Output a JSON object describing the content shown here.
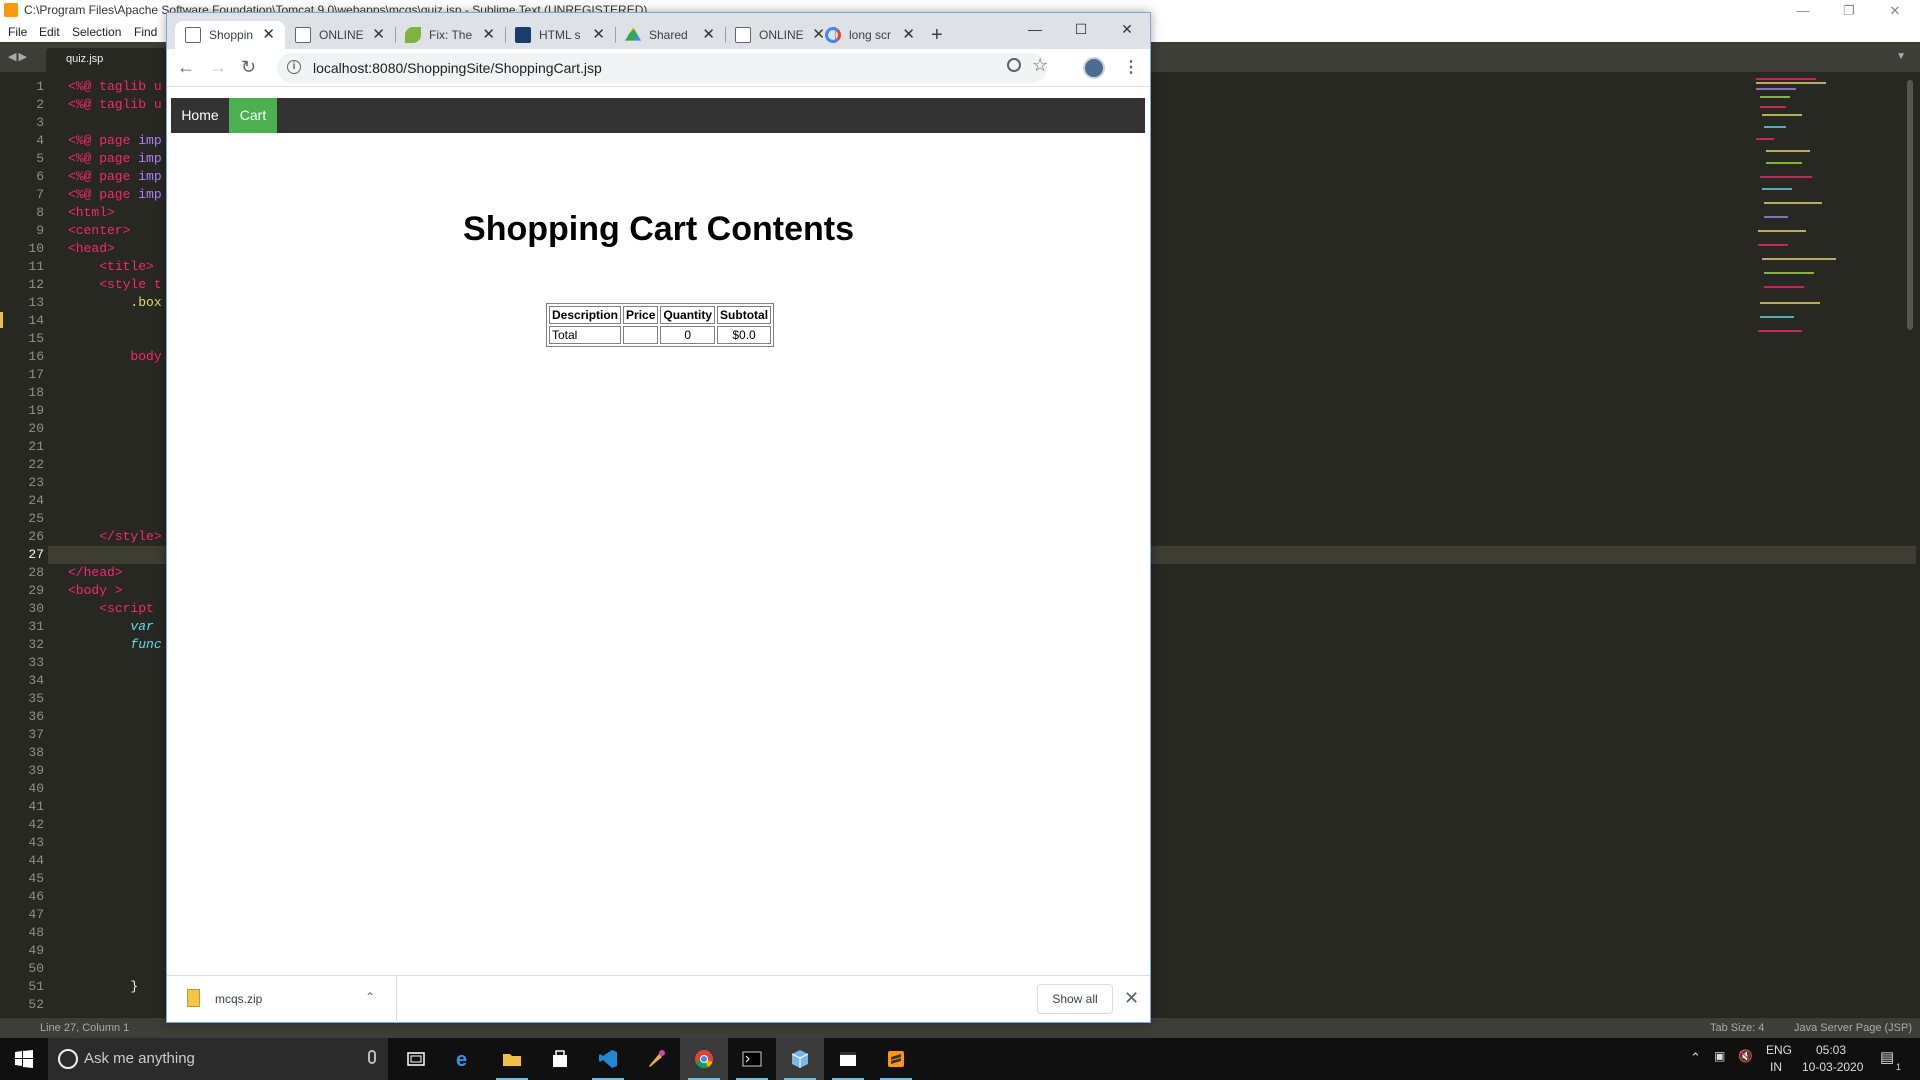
{
  "sublime": {
    "title": "C:\\Program Files\\Apache Software Foundation\\Tomcat 9.0\\webapps\\mcqs\\quiz.jsp - Sublime Text (UNREGISTERED)",
    "menu": [
      "File",
      "Edit",
      "Selection",
      "Find"
    ],
    "tab": "quiz.jsp",
    "line_numbers": [
      "1",
      "2",
      "3",
      "4",
      "5",
      "6",
      "7",
      "8",
      "9",
      "10",
      "11",
      "12",
      "13",
      "14",
      "15",
      "16",
      "17",
      "18",
      "19",
      "20",
      "21",
      "22",
      "23",
      "24",
      "25",
      "26",
      "27",
      "28",
      "29",
      "30",
      "31",
      "32",
      "33",
      "34",
      "35",
      "36",
      "37",
      "38",
      "39",
      "40",
      "41",
      "42",
      "43",
      "44",
      "45",
      "46",
      "47",
      "48",
      "49",
      "50",
      "51",
      "52"
    ],
    "code": {
      "l1a": "<%@",
      "l1b": " taglib u",
      "l2a": "<%@",
      "l2b": " taglib u",
      "l4a": "<%@",
      "l4b": " page",
      "l4c": " imp",
      "l5a": "<%@",
      "l5b": " page",
      "l5c": " imp",
      "l6a": "<%@",
      "l6b": " page",
      "l6c": " imp",
      "l7a": "<%@",
      "l7b": " page",
      "l7c": " imp",
      "l8": "<html>",
      "l9": "<center>",
      "l10": "<head>",
      "l11": "<title>",
      "l12a": "<style",
      "l12b": " t",
      "l13": ".box",
      "l16": "body",
      "l26": "</style>",
      "l28": "</head>",
      "l29": "<body >",
      "l30": "<script",
      "l31": "var",
      "l32": "func",
      "l51": "}"
    },
    "status_left": "Line 27, Column 1",
    "status_tabsize": "Tab Size: 4",
    "status_syntax": "Java Server Page (JSP)"
  },
  "chrome": {
    "tabs": [
      {
        "label": "Shoppin",
        "active": true
      },
      {
        "label": "ONLINE",
        "active": false
      },
      {
        "label": "Fix: The",
        "active": false
      },
      {
        "label": "HTML s",
        "active": false
      },
      {
        "label": "Shared",
        "active": false
      },
      {
        "label": "ONLINE",
        "active": false
      },
      {
        "label": "long scr",
        "active": false
      }
    ],
    "url": "localhost:8080/ShoppingSite/ShoppingCart.jsp",
    "download": {
      "filename": "mcqs.zip",
      "show_all": "Show all"
    }
  },
  "page": {
    "nav": {
      "home": "Home",
      "cart": "Cart"
    },
    "heading": "Shopping Cart Contents",
    "table": {
      "headers": [
        "Description",
        "Price",
        "Quantity",
        "Subtotal"
      ],
      "total_row": {
        "description": "Total",
        "price": "",
        "quantity": "0",
        "subtotal": "$0.0"
      }
    }
  },
  "taskbar": {
    "search_placeholder": "Ask me anything",
    "lang": "ENG",
    "region": "IN",
    "time": "05:03",
    "date": "10-03-2020",
    "notification_count": "1"
  },
  "colors": {
    "nav_bg": "#333333",
    "nav_active": "#4CAF50",
    "editor_bg": "#272822"
  }
}
